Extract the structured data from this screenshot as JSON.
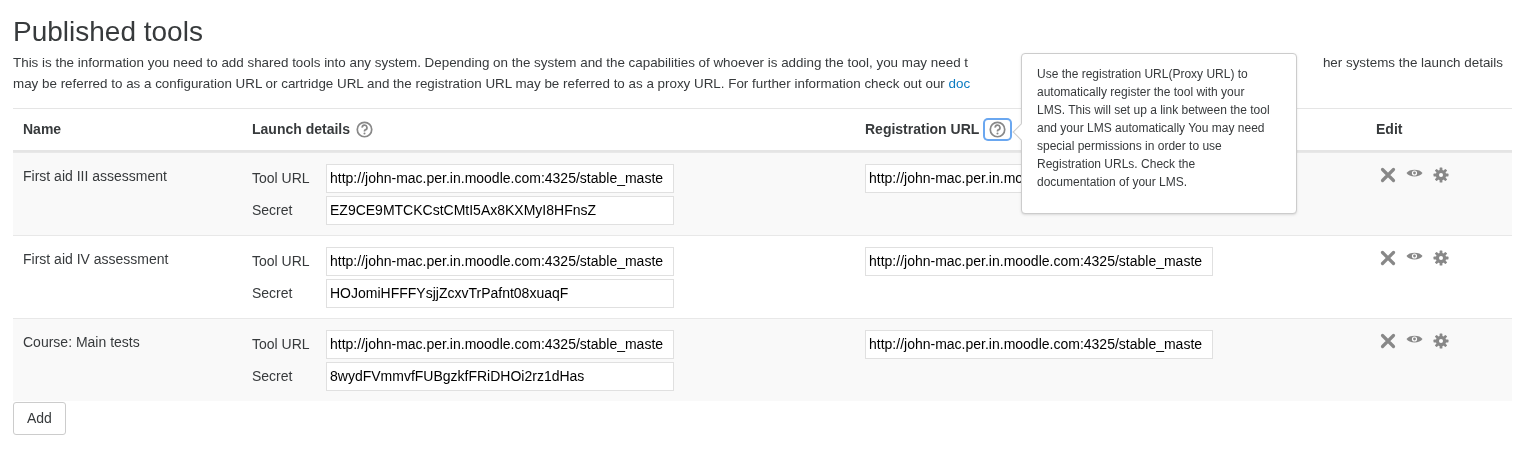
{
  "title": "Published tools",
  "intro": {
    "line_1_start": "This is the information you need to add shared tools into any system. Depending on the system and the capabilities of whoever is adding the tool, you may need t",
    "line_1_end": "her systems the launch details",
    "line_2": "may be referred to as a configuration URL or cartridge URL and the registration URL may be referred to as a proxy URL. For further information check out our",
    "link": "doc"
  },
  "table": {
    "columns": [
      {
        "label": "Name"
      },
      {
        "label": "Launch details",
        "help": {
          "focused": false
        }
      },
      {
        "label": "Registration URL",
        "help": {
          "focused": true
        }
      },
      {
        "label": "Edit"
      }
    ],
    "rows": [
      {
        "name": "First aid III assessment",
        "tool_url_label": "Tool URL",
        "tool_url": "http://john-mac.per.in.moodle.com:4325/stable_maste",
        "secret_label": "Secret",
        "secret": "EZ9CE9MTCKCstCMtI5Ax8KXMyI8HFnsZ",
        "registration_url": "http://john-mac.per.in.mo"
      },
      {
        "name": "First aid IV assessment",
        "tool_url_label": "Tool URL",
        "tool_url": "http://john-mac.per.in.moodle.com:4325/stable_maste",
        "secret_label": "Secret",
        "secret": "HOJomiHFFFYsjjZcxvTrPafnt08xuaqF",
        "registration_url": "http://john-mac.per.in.moodle.com:4325/stable_maste"
      },
      {
        "name": "Course: Main tests",
        "tool_url_label": "Tool URL",
        "tool_url": "http://john-mac.per.in.moodle.com:4325/stable_maste",
        "secret_label": "Secret",
        "secret": "8wydFVmmvfFUBgzkfFRiDHOi2rz1dHas",
        "registration_url": "http://john-mac.per.in.moodle.com:4325/stable_maste"
      }
    ]
  },
  "tooltip": {
    "text": "Use the registration URL(Proxy URL) to automatically register the tool with your LMS. This will set up a link between the tool and your LMS automatically You may need special permissions in order to use Registration URLs. Check the documentation of your LMS."
  },
  "add_button": "Add"
}
